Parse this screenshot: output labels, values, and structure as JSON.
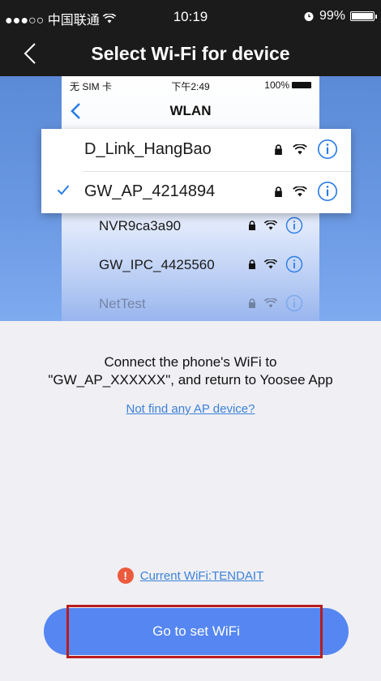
{
  "status_bar": {
    "carrier": "●●●○○ 中国联通",
    "time": "10:19",
    "battery": "99%",
    "battery_level": 0.99
  },
  "nav": {
    "title": "Select Wi-Fi for device"
  },
  "illustration": {
    "status_left": "无 SIM 卡",
    "status_time": "下午2:49",
    "status_right": "100%",
    "title": "WLAN",
    "highlight_networks": [
      {
        "name": "D_Link_HangBao",
        "selected": false
      },
      {
        "name": "GW_AP_4214894",
        "selected": true
      }
    ],
    "networks": [
      {
        "name": "NVR9ca3a90"
      },
      {
        "name": "GW_IPC_4425560"
      },
      {
        "name": "NetTest"
      }
    ]
  },
  "instructions": {
    "line1": "Connect the phone's WiFi to",
    "line2": "\"GW_AP_XXXXXX\", and return to Yoosee App"
  },
  "links": {
    "not_find": "Not find any AP device?",
    "current_wifi": "Current WiFi:TENDAIT"
  },
  "warning_glyph": "!",
  "button": {
    "go_set_wifi": "Go to set WiFi"
  },
  "colors": {
    "accent": "#5586f1",
    "link": "#3c82d8",
    "warning": "#ec5a3d",
    "highlight_box": "#b81d1d",
    "topbar": "#1b1b1b"
  }
}
